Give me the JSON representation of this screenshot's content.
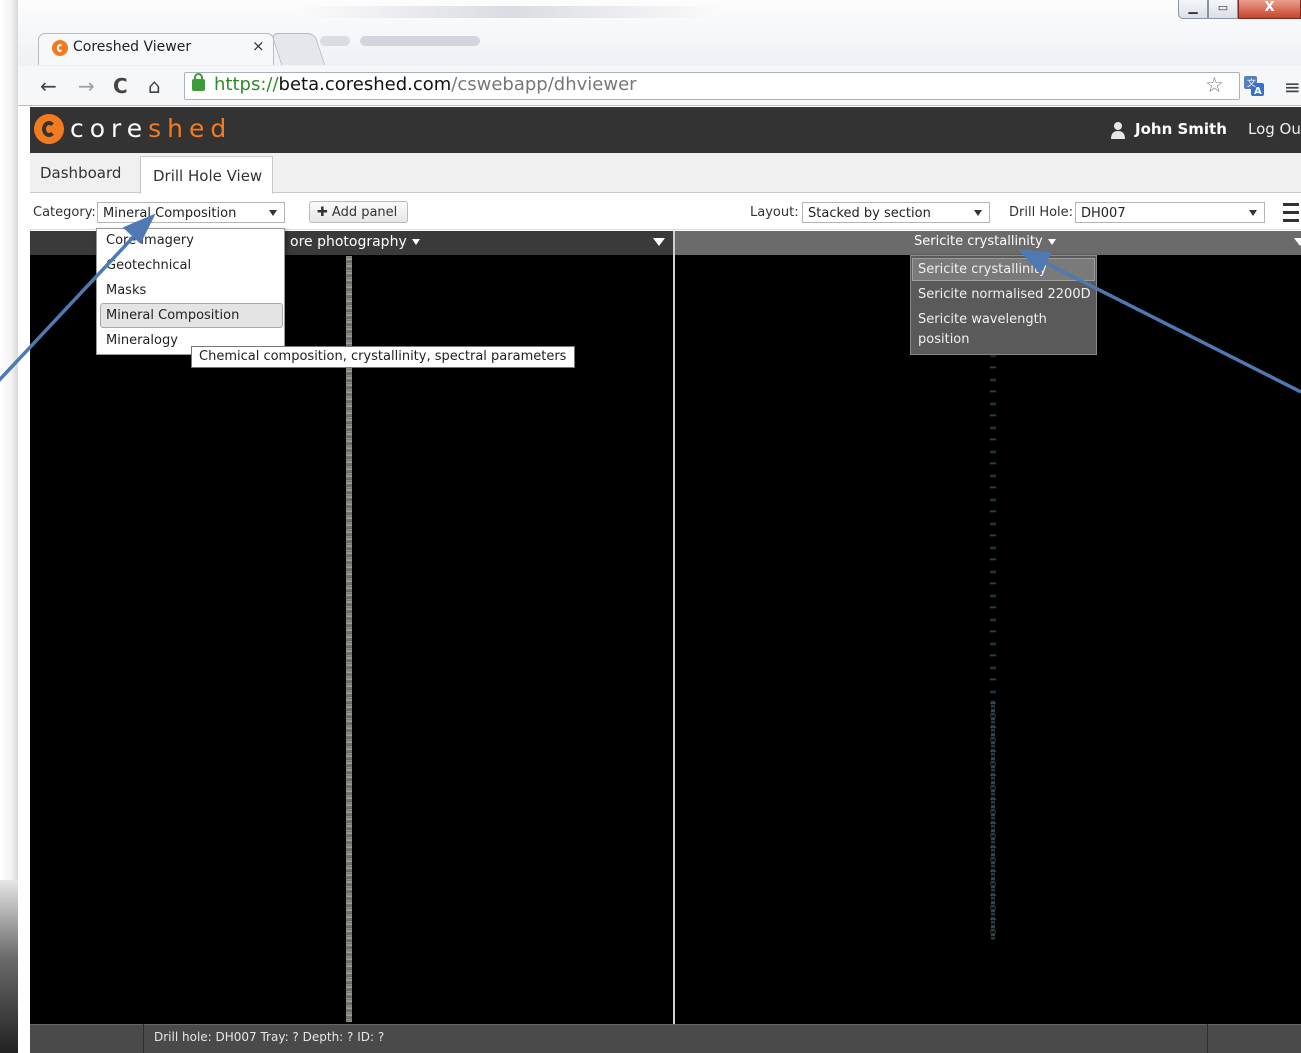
{
  "browser": {
    "tab_title": "Coreshed Viewer",
    "tab_close": "×",
    "url_scheme": "https://",
    "url_host": "beta.coreshed.com",
    "url_path": "/cswebapp/dhviewer",
    "icons": [
      "back-icon",
      "forward-icon",
      "reload-icon",
      "home-icon",
      "lock-icon",
      "star-icon",
      "translate-icon",
      "menu-icon",
      "minimize-icon",
      "maximize-icon",
      "close-icon"
    ],
    "close_glyph": "X",
    "max_glyph": "▭",
    "min_glyph": "▁"
  },
  "app": {
    "logo_a": "core",
    "logo_b": "shed",
    "user_name": "John Smith",
    "logout": "Log Ou",
    "tabs": [
      {
        "label": "Dashboard"
      },
      {
        "label": "Drill Hole View"
      }
    ],
    "accent_color": "#f47a20",
    "header_color": "#333333"
  },
  "controls": {
    "category_label": "Category:",
    "category_value": "Mineral Composition",
    "add_panel_label": "Add panel",
    "layout_label": "Layout:",
    "layout_value": "Stacked by section",
    "drillhole_label": "Drill Hole:",
    "drillhole_value": "DH007"
  },
  "category_menu": {
    "items": [
      {
        "label": "Core Imagery"
      },
      {
        "label": "Geotechnical"
      },
      {
        "label": "Masks"
      },
      {
        "label": "Mineral Composition"
      },
      {
        "label": "Mineralogy"
      }
    ],
    "hovered": "Mineral Composition",
    "tooltip": "Chemical composition, crystallinity, spectral parameters"
  },
  "panels": {
    "left_title": "ore photography",
    "right_title": "Sericite crystallinity"
  },
  "layer_menu": {
    "items": [
      {
        "label": "Sericite crystallinity"
      },
      {
        "label": "Sericite normalised 2200D"
      },
      {
        "label": "Sericite wavelength"
      },
      {
        "label": "position"
      }
    ],
    "selected": "Sericite crystallinity"
  },
  "status": {
    "text": "Drill hole: DH007 Tray: ? Depth: ? ID: ?"
  }
}
